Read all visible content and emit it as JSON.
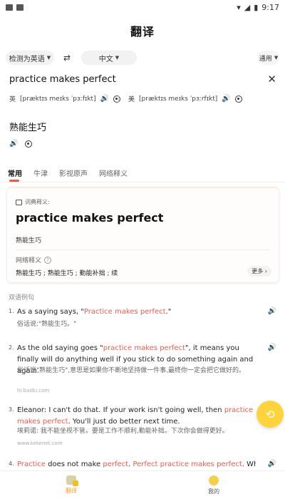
{
  "status": {
    "time": "9:17"
  },
  "header": {
    "title": "翻译"
  },
  "langbar": {
    "source": "检测为英语",
    "target": "中文",
    "swap": "⇄",
    "mode": "通用"
  },
  "input": {
    "query": "practice makes perfect",
    "uk_label": "英",
    "uk_phonetic": "[præktɪs meɪks ˈpɜːfɪkt]",
    "us_label": "美",
    "us_phonetic": "[præktɪs meɪks ˈpɜːrfɪkt]"
  },
  "result": {
    "text": "熟能生巧"
  },
  "tabs": [
    {
      "label": "常用"
    },
    {
      "label": "牛津"
    },
    {
      "label": "影视原声"
    },
    {
      "label": "网络释义"
    }
  ],
  "dictionary": {
    "heading": "词典释义:",
    "word": "practice makes perfect",
    "definition": "熟能生巧",
    "net_label": "网络释义",
    "net_text": "熟能生巧 ; 熟能生巧 ; 勤能补拙 ; 续",
    "more_label": "更多"
  },
  "bilingual": {
    "title": "双语例句",
    "sentences": [
      {
        "num": "1.",
        "en_a": "As a saying says, \"",
        "en_hl": "Practice makes perfect",
        "en_b": ".\"",
        "zh": "俗话说:\"熟能生巧。\"",
        "source": ""
      },
      {
        "num": "2.",
        "en_a": "As the old saying goes \"",
        "en_hl": "practice makes perfect",
        "en_b": "\", it means you finally will do anything well if you stick to do something again and again.",
        "zh": "俗话说\"熟能生巧\",意思是如果你不断地坚持做一件事,最终你一定会把它做好的。",
        "source": "hi.baidu.com"
      },
      {
        "num": "3.",
        "en_a": "Eleanor: I can't do that. If your work isn't going well, then ",
        "en_hl": "practice makes perfect",
        "en_b": ". You'll just do better next time.",
        "zh": "埃莉诺: 我不能坐视不管。要是工作不顺利,勤能补拙。下次你会做得更好。",
        "source": "www.kekenet.com"
      },
      {
        "num": "4.",
        "p1": "Practice",
        "p2": " does not make ",
        "p3": "perfect",
        "p4": ". ",
        "p5": "Perfect practice makes perfect",
        "p6": ". What"
      }
    ]
  },
  "nav": {
    "translate": "翻译",
    "me": "我的"
  },
  "colors": {
    "accent": "#f05a4a",
    "fab": "#ffd43b",
    "nav_active": "#f0a020"
  }
}
